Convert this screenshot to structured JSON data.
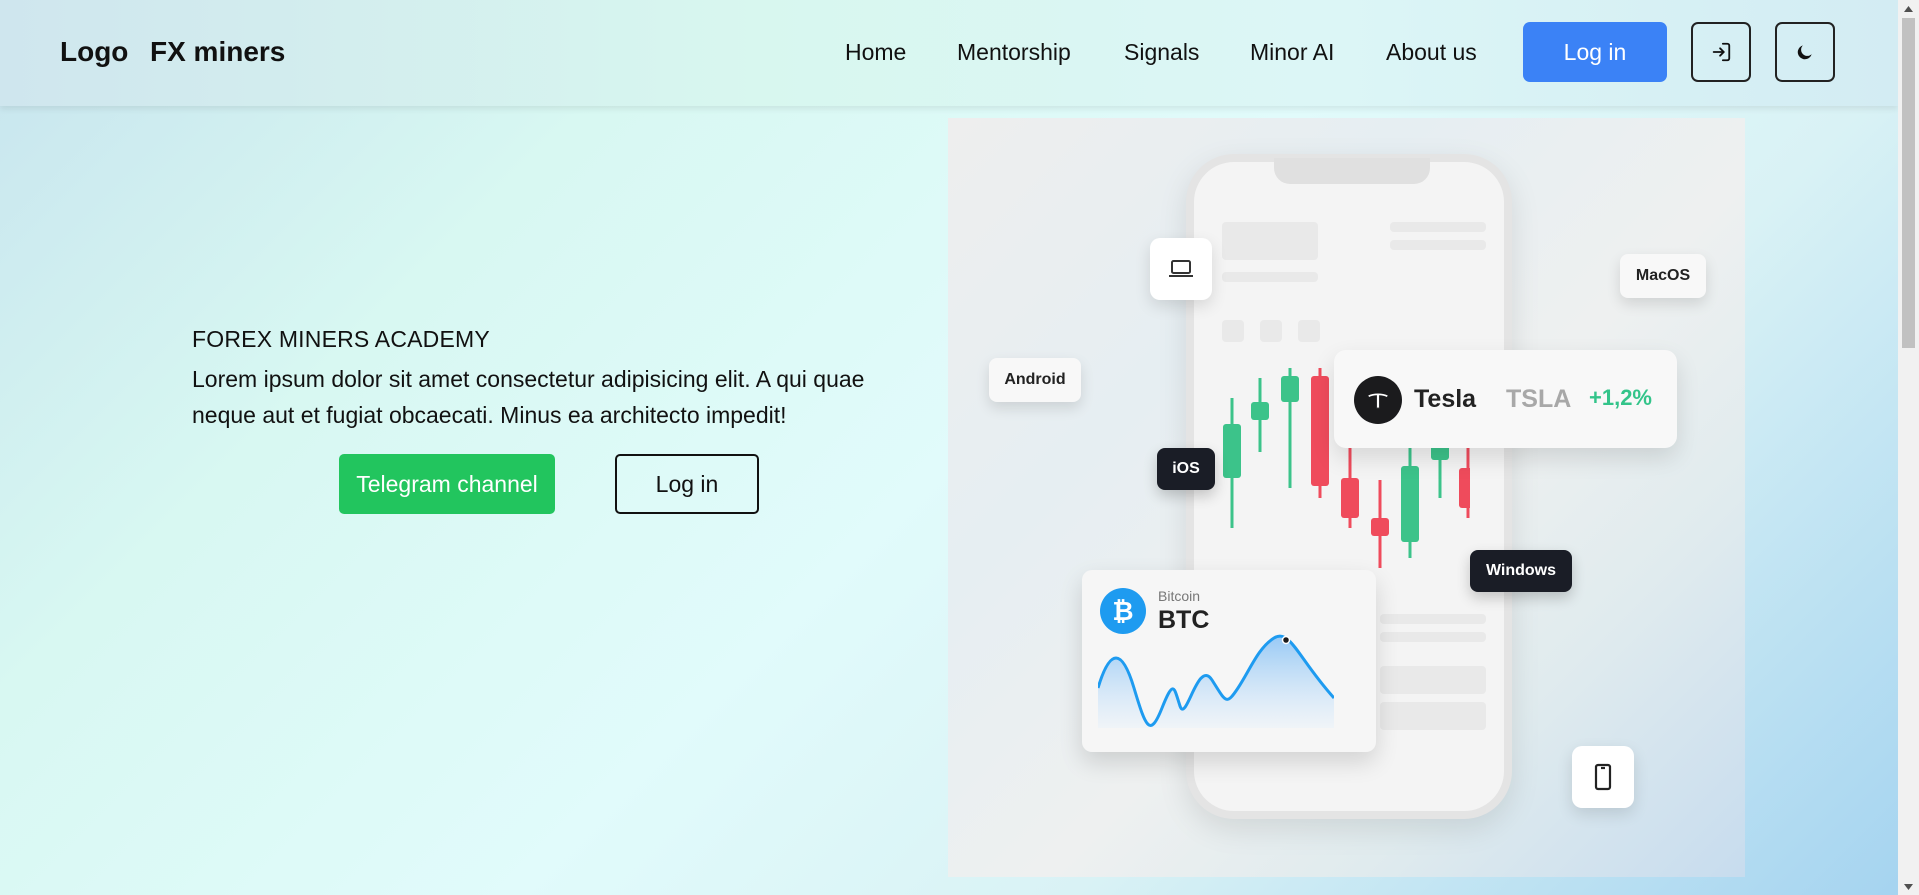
{
  "header": {
    "logo": "Logo",
    "brand": "FX miners",
    "nav": [
      "Home",
      "Mentorship",
      "Signals",
      "Minor AI",
      "About us"
    ],
    "login_label": "Log in",
    "icons": {
      "signin": "sign-in-icon",
      "theme": "moon-icon"
    }
  },
  "hero": {
    "title": "FOREX MINERS ACADEMY",
    "description": "Lorem ipsum dolor sit amet consectetur adipisicing elit. A qui quae neque aut et fugiat obcaecati. Minus ea architecto impedit!",
    "telegram_label": "Telegram channel",
    "login_label": "Log in"
  },
  "illustration": {
    "chips": {
      "android": "Android",
      "macos": "MacOS",
      "ios": "iOS",
      "windows": "Windows"
    },
    "tesla": {
      "name": "Tesla",
      "ticker": "TSLA",
      "change": "+1,2%"
    },
    "btc": {
      "subtitle": "Bitcoin",
      "name": "BTC"
    }
  },
  "colors": {
    "primary": "#3b82f6",
    "success": "#22c55e",
    "candle_up": "#3cc38a",
    "candle_down": "#ef4b5c",
    "btc": "#1e9bf0"
  }
}
